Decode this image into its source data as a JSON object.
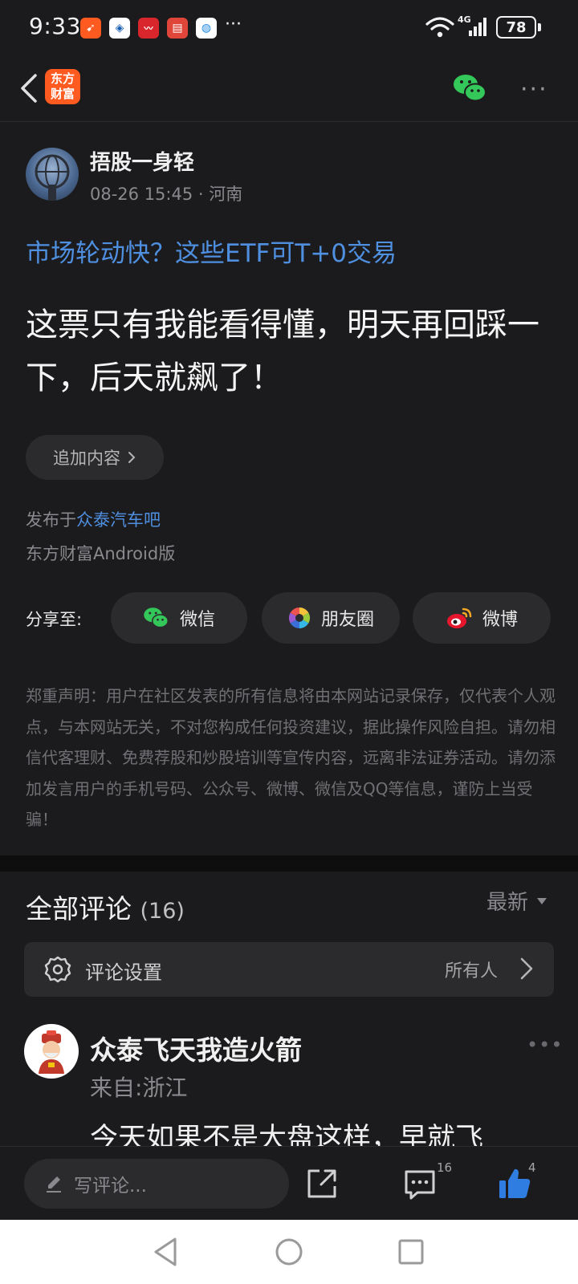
{
  "status_bar": {
    "time": "9:33",
    "battery": "78",
    "notification_icons": [
      "transfer-app-icon",
      "bank-app-icon",
      "stock-app-icon",
      "book-app-icon",
      "browser-app-icon"
    ],
    "overflow": "···",
    "network": "4G"
  },
  "header": {
    "logo_text": "东方\n财富",
    "brand_color": "#ff5a1f",
    "more": "···"
  },
  "post": {
    "author": "捂股一身轻",
    "meta": "08-26 15:45 · 河南",
    "topic_link": "市场轮动快？这些ETF可T+0交易",
    "body": "这票只有我能看得懂，明天再回踩一下，后天就飙了！",
    "add_content": "追加内容",
    "published_prefix": "发布于",
    "published_forum": "众泰汽车吧",
    "client": "东方财富Android版",
    "link_color": "#4f8fe0"
  },
  "share": {
    "label": "分享至:",
    "buttons": [
      {
        "label": "微信",
        "icon": "wechat-icon"
      },
      {
        "label": "朋友圈",
        "icon": "moments-icon"
      },
      {
        "label": "微博",
        "icon": "weibo-icon"
      }
    ]
  },
  "disclaimer": "郑重声明：用户在社区发表的所有信息将由本网站记录保存，仅代表个人观点，与本网站无关，不对您构成任何投资建议，据此操作风险自担。请勿相信代客理财、免费荐股和炒股培训等宣传内容，远离非法证券活动。请勿添加发言用户的手机号码、公众号、微博、微信及QQ等信息，谨防上当受骗！",
  "comments": {
    "title": "全部评论",
    "count": "(16)",
    "sort": "最新",
    "settings_label": "评论设置",
    "settings_value": "所有人",
    "first": {
      "name": "众泰飞天我造火箭",
      "location": "来自:浙江",
      "text": "今天如果不是大盘这样，早就飞"
    }
  },
  "bottom_bar": {
    "input_placeholder": "写评论...",
    "comment_count": "16",
    "like_count": "4",
    "like_color": "#2f7de1"
  }
}
